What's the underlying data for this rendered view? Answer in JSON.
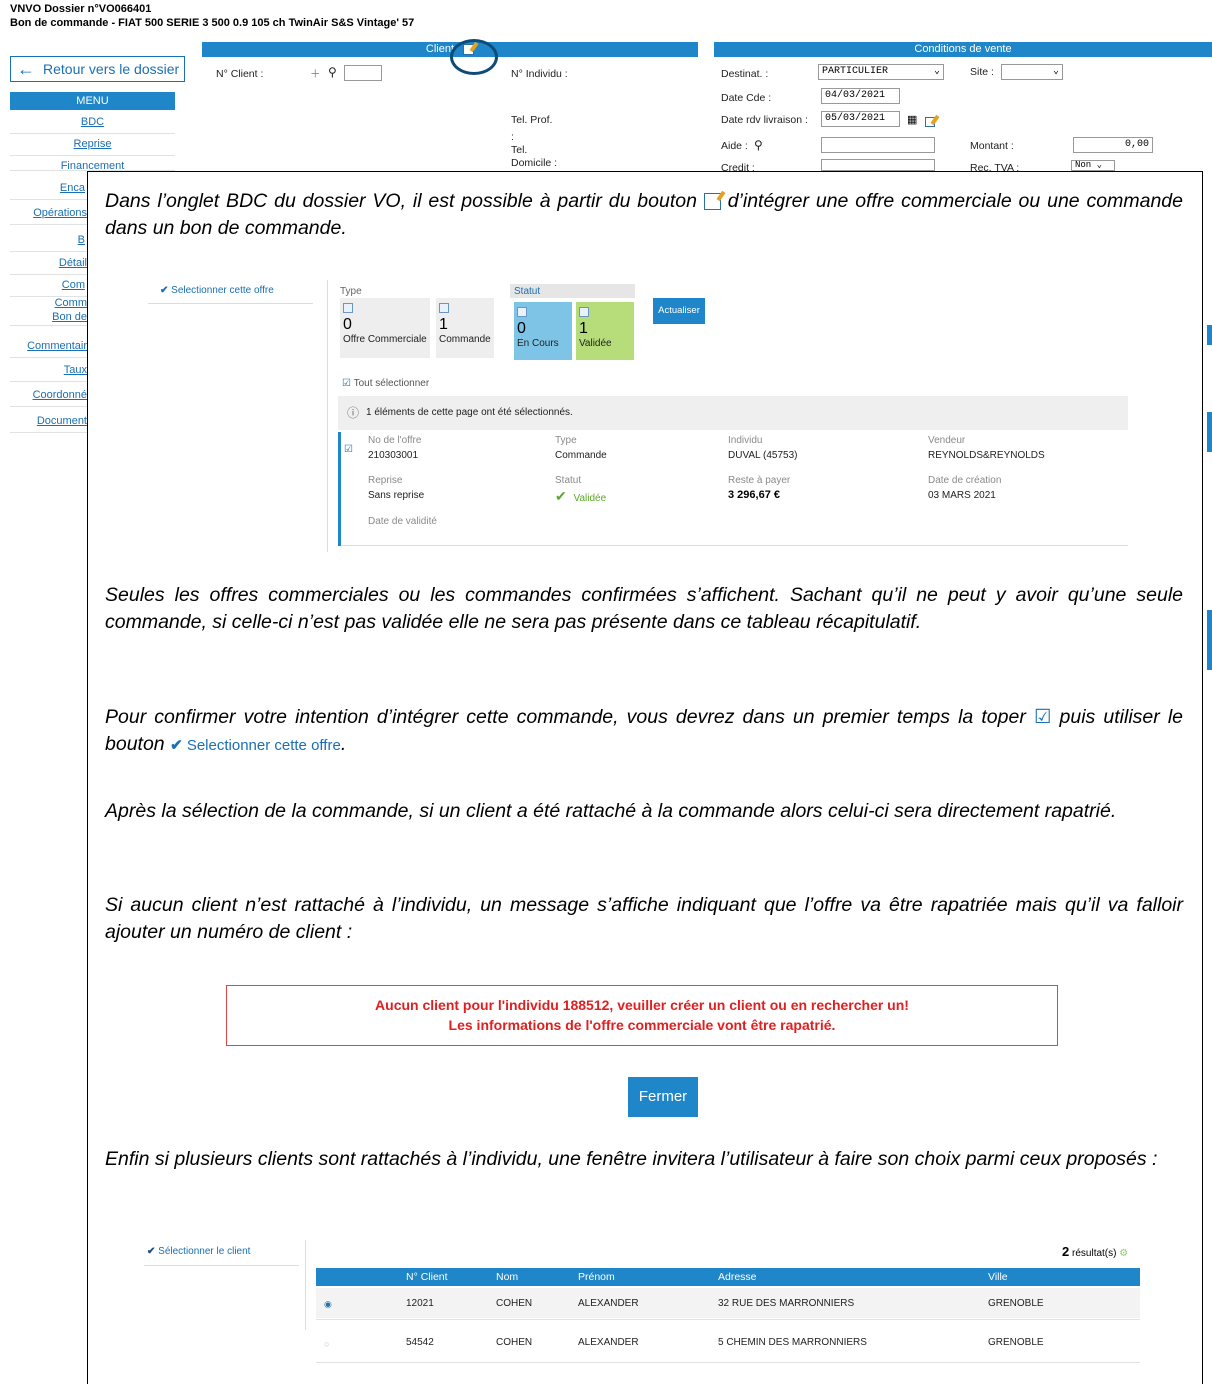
{
  "header": {
    "dossier": "VNVO Dossier n°VO066401",
    "title": "Bon de commande - FIAT 500 SERIE 3 500 0.9 105 ch TwinAir S&S Vintage' 57"
  },
  "back_button": {
    "label": "Retour vers le dossier"
  },
  "menu": {
    "title": "MENU",
    "items": [
      "BDC",
      "Reprise",
      "Financement",
      "Enca",
      "Opérations",
      "B",
      "Détail",
      "Com",
      "Comm",
      "Bon de",
      "Commentair",
      "Taux",
      "Coordonné",
      "Document"
    ]
  },
  "client_panel": {
    "title": "Client",
    "no_client_label": "N° Client :",
    "no_individu_label": "N° Individu :",
    "tel_prof_label": "Tel. Prof.",
    "colon": ":",
    "tel_label": "Tel.",
    "domicile_label": "Domicile :"
  },
  "conditions_panel": {
    "title": "Conditions de vente",
    "destinat_label": "Destinat. :",
    "destinat_value": "PARTICULIER",
    "site_label": "Site :",
    "site_value": "",
    "date_cde_label": "Date Cde :",
    "date_cde_value": "04/03/2021",
    "date_rdv_label": "Date rdv livraison :",
    "date_rdv_value": "05/03/2021",
    "aide_label": "Aide :",
    "montant_label": "Montant :",
    "montant_value": "0,00",
    "credit_label": "Credit :",
    "rec_tva_label": "Rec. TVA :",
    "rec_tva_value": "Non"
  },
  "doc": {
    "p1a": "Dans l’onglet BDC du dossier VO, il est possible à partir du bouton",
    "p1b": "d’intégrer une offre commerciale ou une commande dans un bon de commande.",
    "p2": "Seules les offres commerciales ou les commandes confirmées s’affichent. Sachant qu’il ne peut y avoir qu’une seule commande, si celle-ci n’est pas validée elle ne sera pas présente dans ce tableau récapitulatif.",
    "p3a": "Pour confirmer votre intention d’intégrer cette commande, vous devrez dans un premier temps la toper",
    "p3b": "puis utiliser le bouton",
    "p3c": ".",
    "p4": "Après la sélection de la commande, si un client a été rattaché à la commande alors celui-ci sera directement rapatrié.",
    "p5": "Si aucun client n’est rattaché à l’individu, un message s’affiche indiquant que l’offre va être rapatriée mais qu’il va falloir ajouter un numéro de client :",
    "p6": "Enfin si plusieurs clients sont rattachés à l’individu, une fenêtre invitera l’utilisateur à faire son choix parmi ceux proposés :"
  },
  "offer_screen": {
    "select_btn": "Selectionner cette offre",
    "type_label": "Type",
    "statut_label": "Statut",
    "tiles": [
      {
        "count": "0",
        "label": "Offre Commerciale"
      },
      {
        "count": "1",
        "label": "Commande"
      },
      {
        "count": "0",
        "label": "En Cours"
      },
      {
        "count": "1",
        "label": "Validée"
      }
    ],
    "refresh_btn": "Actualiser",
    "select_all": "Tout sélectionner",
    "info": "1 éléments de cette page ont été sélectionnés.",
    "fields": {
      "no_offre_label": "No de l'offre",
      "no_offre": "210303001",
      "type_label": "Type",
      "type": "Commande",
      "individu_label": "Individu",
      "individu": "DUVAL (45753)",
      "vendeur_label": "Vendeur",
      "vendeur": "REYNOLDS&REYNOLDS",
      "reprise_label": "Reprise",
      "reprise": "Sans reprise",
      "statut_label": "Statut",
      "statut": "Validée",
      "reste_label": "Reste à payer",
      "reste": "3 296,67 €",
      "creation_label": "Date de création",
      "creation": "03 MARS 2021",
      "validite_label": "Date de validité"
    }
  },
  "error_msg": {
    "line1": "Aucun client pour l'individu 188512, veuiller créer un client ou en rechercher un!",
    "line2": "Les informations de l'offre commerciale vont être rapatrié."
  },
  "close_btn": "Fermer",
  "client_table": {
    "select_btn": "Sélectionner le client",
    "result_count": "2",
    "result_label": "résultat(s)",
    "columns": [
      "N° Client",
      "Nom",
      "Prénom",
      "Adresse",
      "Ville"
    ],
    "rows": [
      [
        "12021",
        "COHEN",
        "ALEXANDER",
        "32 RUE DES MARRONNIERS",
        "GRENOBLE"
      ],
      [
        "54542",
        "COHEN",
        "ALEXANDER",
        "5 CHEMIN DES MARRONNIERS",
        "GRENOBLE"
      ]
    ]
  },
  "colors": {
    "accent": "#1f86c9",
    "error": "#e02020",
    "tile_blue": "#7dc4e6",
    "tile_green": "#b7dc7a"
  }
}
